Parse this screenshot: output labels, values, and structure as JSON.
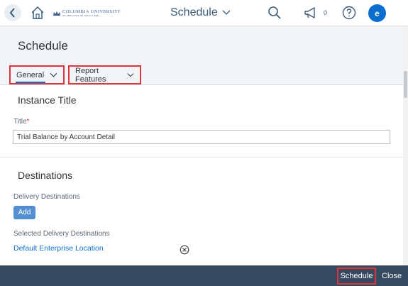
{
  "shell": {
    "logo_line1": "COLUMBIA UNIVERSITY",
    "logo_line2": "IN THE CITY OF NEW YORK",
    "app_title": "Schedule",
    "notification_count": "0",
    "avatar_initial": "e",
    "icons": [
      "back-icon",
      "home-icon",
      "chevron-down-icon",
      "search-icon",
      "megaphone-icon",
      "help-icon"
    ]
  },
  "page": {
    "title": "Schedule",
    "tabs": [
      {
        "label": "General",
        "selected": true
      },
      {
        "label": "Report Features",
        "selected": false
      }
    ]
  },
  "instance": {
    "section_title": "Instance Title",
    "title_label": "Title",
    "required_marker": "*",
    "title_value": "Trial Balance by Account Detail"
  },
  "destinations": {
    "section_title": "Destinations",
    "delivery_label": "Delivery Destinations",
    "add_label": "Add",
    "selected_label": "Selected Delivery Destinations",
    "items": [
      {
        "name": "Default Enterprise Location"
      }
    ]
  },
  "footer": {
    "schedule_label": "Schedule",
    "close_label": "Close"
  },
  "colors": {
    "accent": "#0a6ed1",
    "footer_bg": "#354a5f",
    "highlight_box": "#d9363e"
  }
}
